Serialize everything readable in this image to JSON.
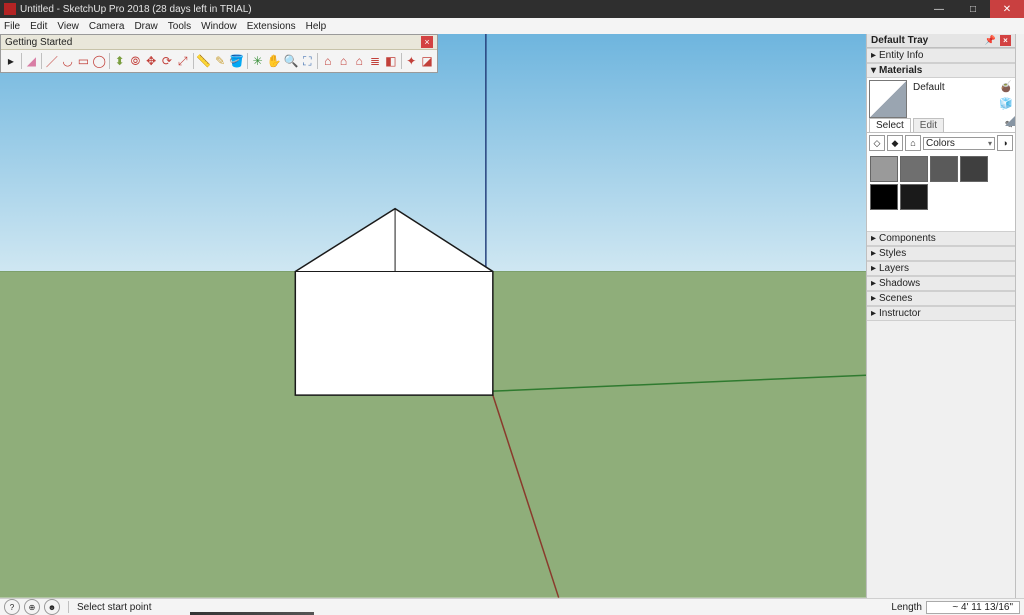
{
  "titlebar": {
    "title": "Untitled - SketchUp Pro 2018 (28 days left in TRIAL)"
  },
  "menu": {
    "items": [
      "File",
      "Edit",
      "View",
      "Camera",
      "Draw",
      "Tools",
      "Window",
      "Extensions",
      "Help"
    ]
  },
  "toolbar": {
    "title": "Getting Started",
    "icons": [
      "select",
      "eraser",
      "line",
      "arc",
      "rectangle",
      "circle",
      "pushpull",
      "offset",
      "move",
      "rotate",
      "scale",
      "tape",
      "text",
      "paint",
      "orbit",
      "pan",
      "zoom",
      "zoomext",
      "whouse1",
      "whouse2",
      "whouse3",
      "layers",
      "3dw",
      "ext",
      "sec"
    ]
  },
  "tray": {
    "title": "Default Tray",
    "entity_info": "Entity Info",
    "materials": {
      "title": "Materials",
      "name": "Default",
      "tab_select": "Select",
      "tab_edit": "Edit",
      "category": "Colors",
      "swatches": [
        "#9a9a9a",
        "#6f6f6f",
        "#5a5a5a",
        "#3f3f3f",
        "#000000",
        "#1a1a1a"
      ]
    },
    "components": "Components",
    "styles": "Styles",
    "layers": "Layers",
    "shadows": "Shadows",
    "scenes": "Scenes",
    "instructor": "Instructor"
  },
  "status": {
    "hint": "Select start point",
    "length_label": "Length",
    "length_value": "~ 4' 11 13/16\""
  }
}
